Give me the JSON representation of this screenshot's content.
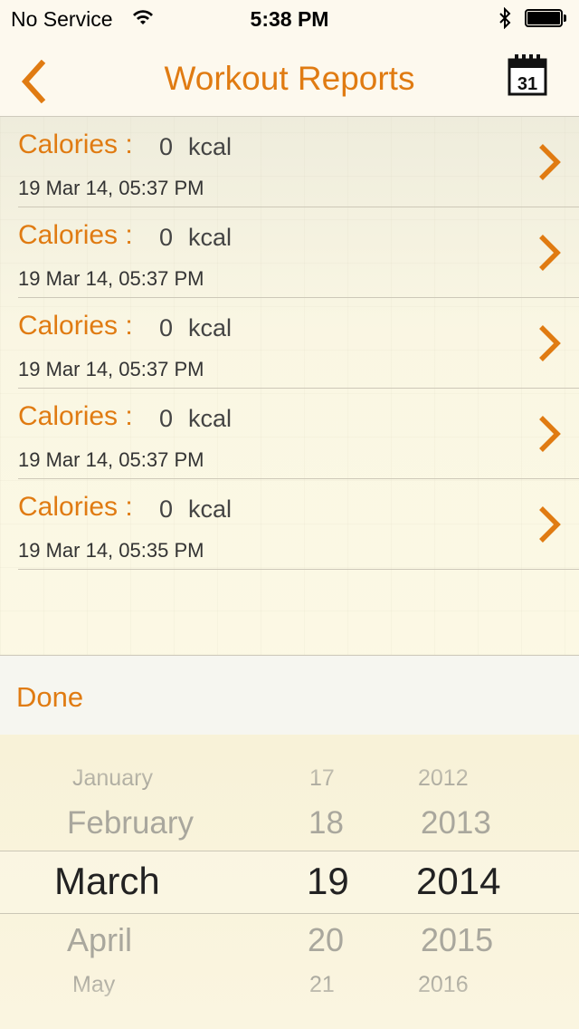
{
  "status_bar": {
    "carrier": "No Service",
    "time": "5:38 PM",
    "icons": [
      "wifi-icon",
      "bluetooth-icon",
      "battery-icon"
    ]
  },
  "nav": {
    "title": "Workout Reports",
    "back_icon": "chevron-left-icon",
    "calendar_icon": "calendar-icon",
    "calendar_day": "31"
  },
  "colors": {
    "accent": "#e07b12",
    "text_dark": "#444444"
  },
  "reports": [
    {
      "label": "Calories :",
      "value": "0",
      "unit": "kcal",
      "date": "19 Mar 14, 05:37 PM"
    },
    {
      "label": "Calories :",
      "value": "0",
      "unit": "kcal",
      "date": "19 Mar 14, 05:37 PM"
    },
    {
      "label": "Calories :",
      "value": "0",
      "unit": "kcal",
      "date": "19 Mar 14, 05:37 PM"
    },
    {
      "label": "Calories :",
      "value": "0",
      "unit": "kcal",
      "date": "19 Mar 14, 05:37 PM"
    },
    {
      "label": "Calories :",
      "value": "0",
      "unit": "kcal",
      "date": "19 Mar 14, 05:35 PM"
    }
  ],
  "picker_toolbar": {
    "done_label": "Done"
  },
  "date_picker": {
    "months": [
      "January",
      "February",
      "March",
      "April",
      "May"
    ],
    "days": [
      "17",
      "18",
      "19",
      "20",
      "21"
    ],
    "years": [
      "2012",
      "2013",
      "2014",
      "2015",
      "2016"
    ],
    "selected": {
      "month": "March",
      "day": "19",
      "year": "2014"
    }
  }
}
